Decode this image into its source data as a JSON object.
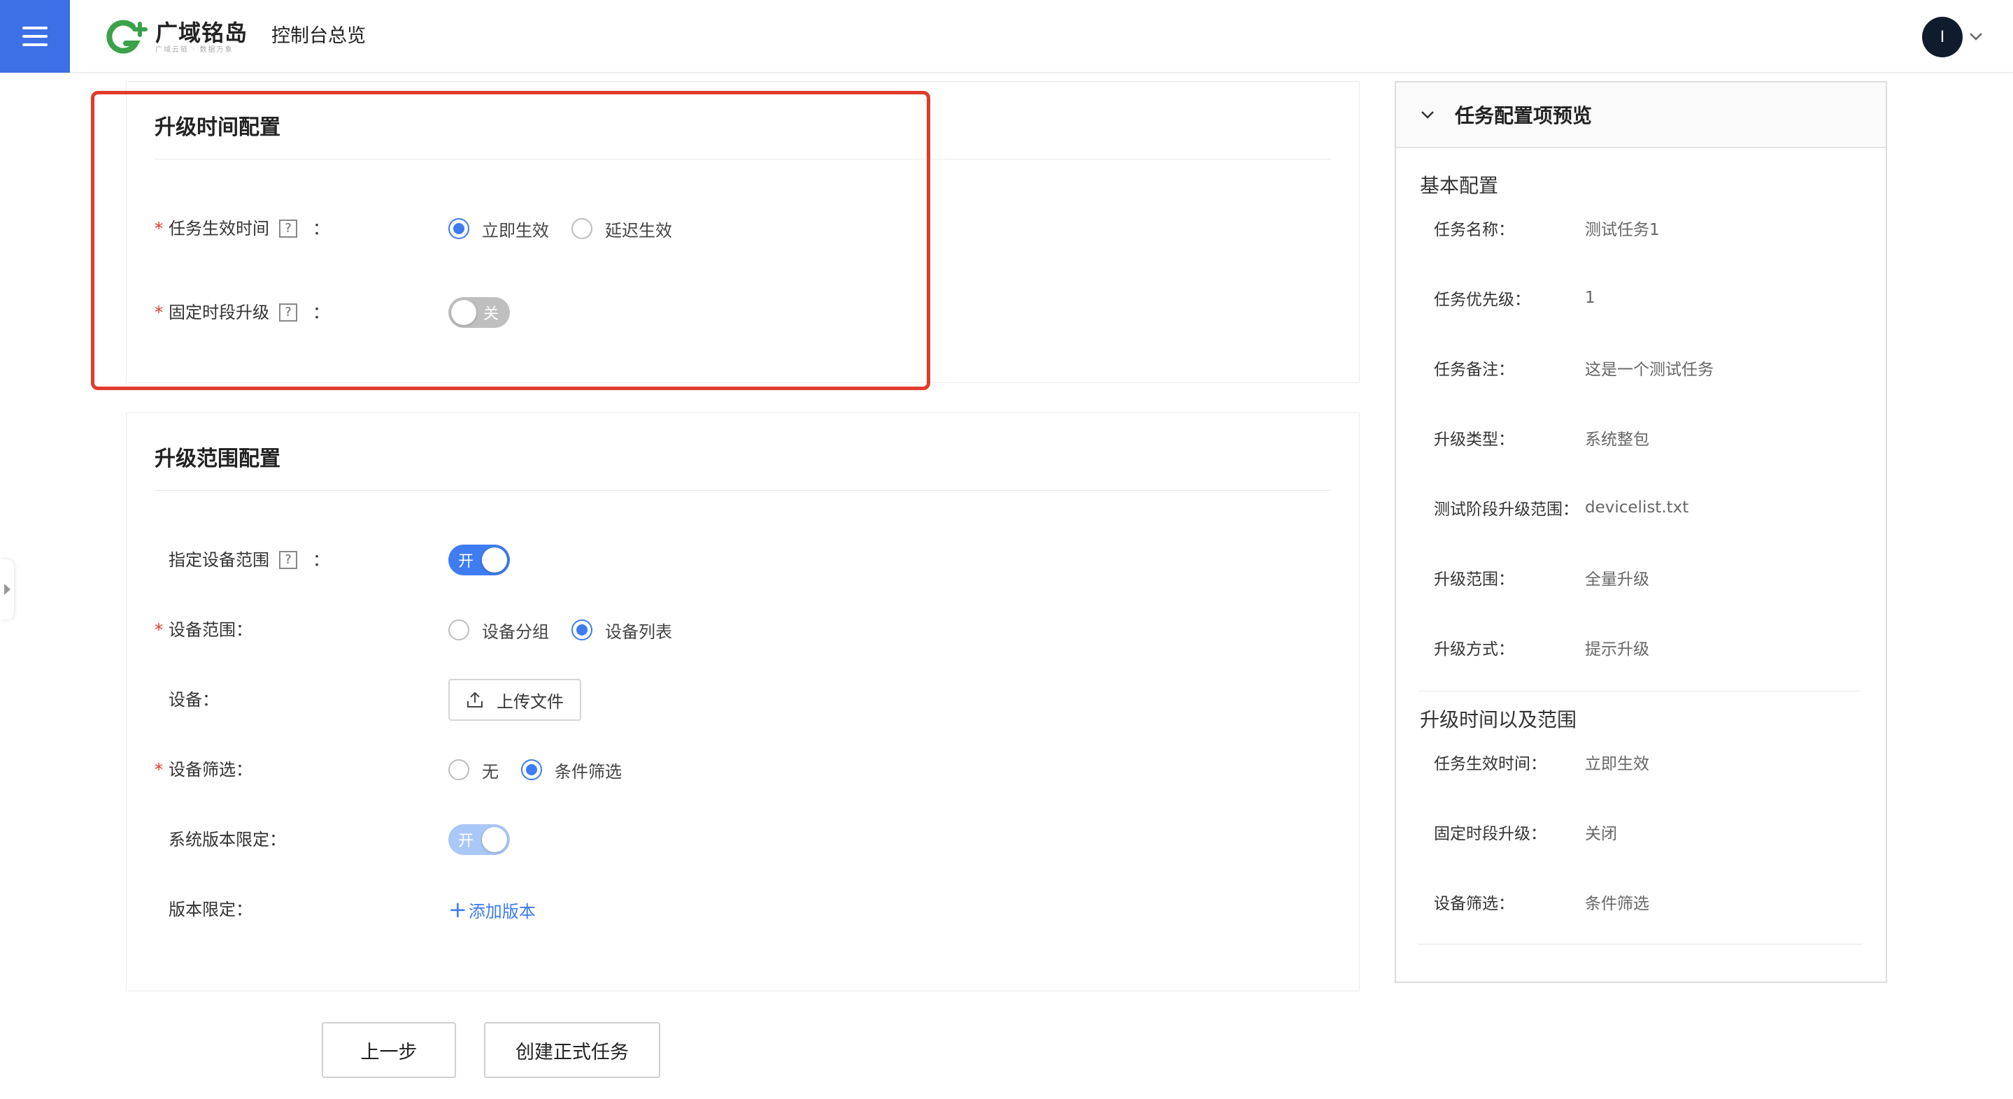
{
  "header": {
    "brand_name": "广域铭岛",
    "brand_sub": "广域云链 · 数据万象",
    "console_title": "控制台总览",
    "avatar_initial": "I",
    "brand_color": "#3d6fe6"
  },
  "time_config": {
    "title": "升级时间配置",
    "effective_time_label": "任务生效时间",
    "help_mark": "?",
    "colon": "：",
    "effective_options": [
      "立即生效",
      "延迟生效"
    ],
    "effective_selected": "立即生效",
    "fixed_period_label": "固定时段升级",
    "fixed_period_switch": "关"
  },
  "scope_config": {
    "title": "升级范围配置",
    "device_scope_label": "指定设备范围",
    "device_scope_switch": "开",
    "device_range_label": "设备范围：",
    "device_range_options": [
      "设备分组",
      "设备列表"
    ],
    "device_range_selected": "设备列表",
    "device_label": "设备：",
    "upload_label": "上传文件",
    "filter_label": "设备筛选：",
    "filter_options": [
      "无",
      "条件筛选"
    ],
    "filter_selected": "条件筛选",
    "sys_version_label": "系统版本限定：",
    "sys_version_switch": "开",
    "version_limit_label": "版本限定：",
    "add_version_label": "添加版本"
  },
  "actions": {
    "prev_label": "上一步",
    "create_label": "创建正式任务"
  },
  "preview": {
    "title": "任务配置项预览",
    "basic_title": "基本配置",
    "basic_rows": [
      {
        "key": "任务名称：",
        "value": "测试任务1"
      },
      {
        "key": "任务优先级：",
        "value": "1"
      },
      {
        "key": "任务备注：",
        "value": "这是一个测试任务"
      },
      {
        "key": "升级类型：",
        "value": "系统整包"
      },
      {
        "key": "测试阶段升级范围：",
        "value": "devicelist.txt"
      },
      {
        "key": "升级范围：",
        "value": "全量升级"
      },
      {
        "key": "升级方式：",
        "value": "提示升级"
      }
    ],
    "time_title": "升级时间以及范围",
    "time_rows": [
      {
        "key": "任务生效时间：",
        "value": "立即生效"
      },
      {
        "key": "固定时段升级：",
        "value": "关闭"
      },
      {
        "key": "设备筛选：",
        "value": "条件筛选"
      }
    ]
  }
}
